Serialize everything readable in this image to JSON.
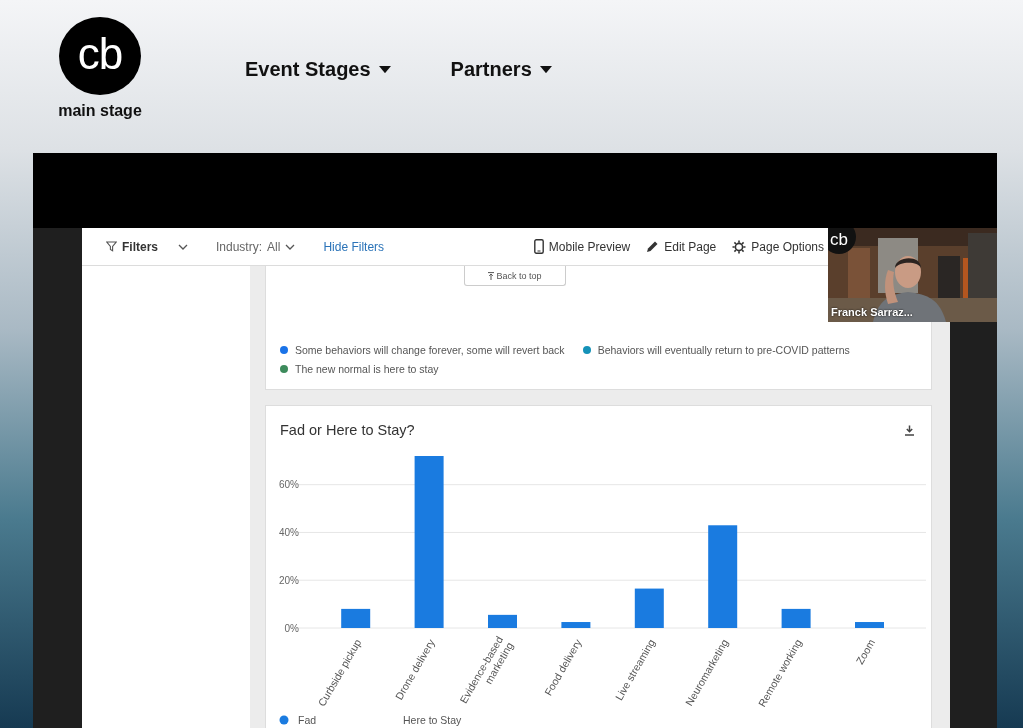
{
  "header": {
    "logo": {
      "mark": "cb",
      "caption": "main stage"
    },
    "nav": [
      {
        "label": "Event Stages"
      },
      {
        "label": "Partners"
      }
    ]
  },
  "toolbar": {
    "filters": "Filters",
    "industry": {
      "label": "Industry:",
      "value": "All"
    },
    "hide_filters": "Hide Filters",
    "actions": [
      {
        "kind": "mobile",
        "label": "Mobile Preview"
      },
      {
        "kind": "edit",
        "label": "Edit Page"
      },
      {
        "kind": "options",
        "label": "Page Options"
      }
    ]
  },
  "back_to_top": "Back to top",
  "legend_card": {
    "items": [
      {
        "label": "Some behaviors will change forever, some will revert back",
        "color": "#1a73e8"
      },
      {
        "label": "Behaviors will eventually return to pre-COVID patterns",
        "color": "#1592b8"
      },
      {
        "label": "The new normal is here to stay",
        "color": "#3d8b5c"
      }
    ]
  },
  "chart_card": {
    "title": "Fad or Here to Stay?",
    "chart_data": {
      "type": "bar",
      "categories": [
        "Curbside pickup",
        "Drone delivery",
        "Evidence-based marketing",
        "Food delivery",
        "Live streaming",
        "Neuromarketing",
        "Remote working",
        "Zoom"
      ],
      "series": [
        {
          "name": "Fad",
          "color": "#1a7be0",
          "values": [
            8,
            72,
            5.5,
            2.5,
            16.5,
            43,
            8,
            2.5
          ]
        },
        {
          "name": "Here to Stay",
          "values": [
            null,
            null,
            null,
            null,
            null,
            null,
            null,
            null
          ]
        }
      ],
      "grid": true,
      "ylim": [
        0,
        72
      ],
      "yticks": [
        {
          "value": 0,
          "label": "0%"
        },
        {
          "value": 20,
          "label": "20%"
        },
        {
          "value": 40,
          "label": "40%"
        },
        {
          "value": 60,
          "label": "60%"
        }
      ]
    }
  },
  "webcam": {
    "badge": "cb",
    "name": "Franck Sarraz..."
  }
}
